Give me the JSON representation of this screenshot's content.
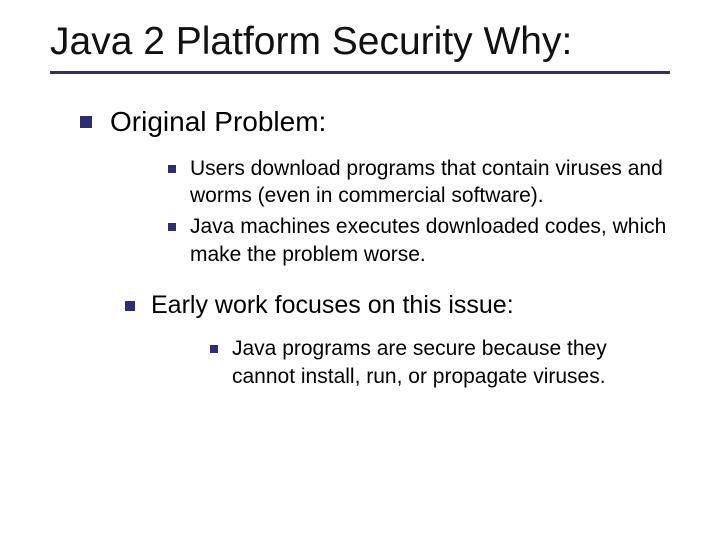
{
  "title": "Java 2 Platform Security Why:",
  "items": [
    {
      "level": "l1",
      "text": "Original Problem:"
    },
    {
      "level": "l2",
      "text": "Users download programs that contain viruses and worms (even in commercial software)."
    },
    {
      "level": "l2",
      "text": "Java machines executes downloaded codes, which make the problem worse."
    },
    {
      "level": "l1b",
      "text": "Early work focuses on this issue:"
    },
    {
      "level": "l2b",
      "text": "Java programs are secure because they cannot install, run, or propagate viruses."
    }
  ]
}
